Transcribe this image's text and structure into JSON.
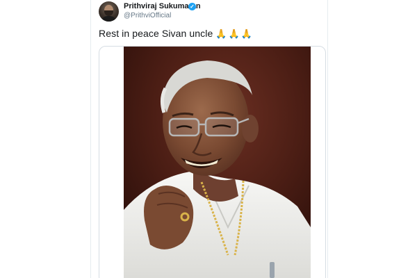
{
  "tweet": {
    "author_name": "Prithviraj Sukumaran",
    "author_handle": "@PrithviOfficial",
    "text": "Rest in peace Sivan uncle",
    "emojis": "🙏🙏🙏",
    "verified_icon": "✓"
  },
  "icons": {
    "avatar": "profile-avatar",
    "verified": "verified-badge-icon",
    "emoji": "folded-hands-emoji"
  },
  "colors": {
    "text_primary": "#14171a",
    "text_secondary": "#657786",
    "verified_blue": "#1da1f2",
    "card_border": "#d6dde3"
  }
}
